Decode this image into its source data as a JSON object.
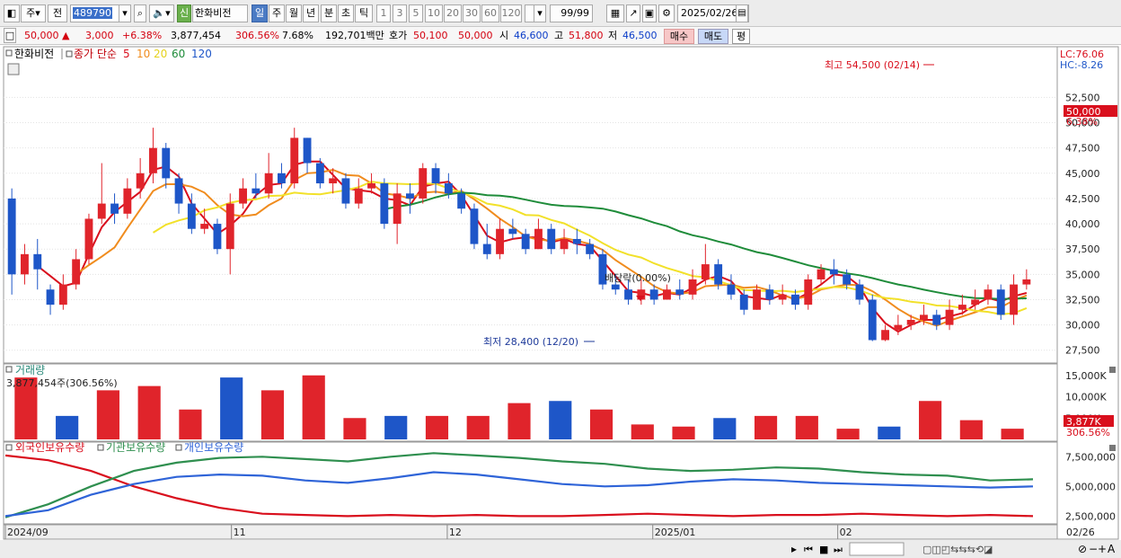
{
  "toolbar": {
    "period_selector": "주",
    "prev_label": "전",
    "stock_code": "489790",
    "market_badge": "신",
    "stock_name": "한화비전",
    "period_tabs": [
      "일",
      "주",
      "월",
      "년",
      "분",
      "초",
      "틱"
    ],
    "active_period": "일",
    "minute_options": [
      "1",
      "3",
      "5",
      "10",
      "20",
      "30",
      "60",
      "120"
    ],
    "count": "99/99",
    "date": "2025/02/26"
  },
  "quote": {
    "price": "50,000",
    "change_arrow": "▲",
    "change": "3,000",
    "change_pct": "+6.38%",
    "volume": "3,877,454",
    "volume_ratio": "306.56%",
    "turnover": "7.68%",
    "amount": "192,701백만",
    "bid_label": "호가",
    "bid": "50,100",
    "ask": "50,000",
    "open_label": "시",
    "open": "46,600",
    "high_label": "고",
    "high": "51,800",
    "low_label": "저",
    "low": "46,500",
    "buy_button": "매수",
    "sell_button": "매도",
    "eval_button": "평"
  },
  "legend": {
    "stock_name": "한화비전",
    "ma_label": "종가 단순",
    "ma_periods": [
      "5",
      "10",
      "20",
      "60",
      "120"
    ],
    "lc_label": "LC:76.06",
    "hc_label": "HC:-8.26"
  },
  "colors": {
    "up": "#e0242b",
    "down": "#1e56c8",
    "ma5": "#d90f1d",
    "ma10": "#f08c1e",
    "ma20": "#f2e12a",
    "ma60": "#1f8c3a",
    "ma120": "#1e56c8",
    "foreign": "#d90f1d",
    "institution": "#2f8f4f",
    "individual": "#2f64d8"
  },
  "annotations": {
    "high_label": "최고 54,500 (02/14)",
    "low_label": "최저 28,400 (12/20)",
    "dividend_label": "배당락(0.00%)",
    "current_price": "50,000",
    "current_pct": "6.38%"
  },
  "volume_panel": {
    "title": "거래량",
    "value_label": "3,877,454주(306.56%)",
    "axis_labels": [
      "15,000K",
      "10,000K",
      "5,000K"
    ],
    "current_label": "3,877K",
    "current_pct": "306.56%"
  },
  "holdings_panel": {
    "legend": [
      "외국인보유수량",
      "기관보유수량",
      "개인보유수량"
    ],
    "axis_labels": [
      "7,500,000",
      "5,000,000",
      "2,500,000"
    ]
  },
  "x_axis": {
    "labels": [
      "2024/09",
      "11",
      "12",
      "2025/01",
      "02",
      "02/26"
    ]
  },
  "chart_data": {
    "type": "candlestick",
    "price_axis": [
      52500,
      50000,
      47500,
      45000,
      42500,
      40000,
      37500,
      35000,
      32500,
      30000,
      27500
    ],
    "ylim": [
      26500,
      56000
    ],
    "candles": [
      [
        42500,
        35000,
        43500,
        33000
      ],
      [
        35000,
        37000,
        38000,
        34000
      ],
      [
        37000,
        35500,
        38500,
        33500
      ],
      [
        33500,
        32000,
        34000,
        31000
      ],
      [
        32000,
        34000,
        35000,
        31500
      ],
      [
        34000,
        36500,
        37500,
        33500
      ],
      [
        36500,
        40500,
        41000,
        36000
      ],
      [
        40500,
        42000,
        46000,
        40000
      ],
      [
        42000,
        41000,
        43000,
        40000
      ],
      [
        41000,
        43500,
        44500,
        40500
      ],
      [
        43500,
        45000,
        46500,
        42500
      ],
      [
        45000,
        47500,
        49500,
        44000
      ],
      [
        47500,
        44500,
        48000,
        43500
      ],
      [
        44500,
        42000,
        45000,
        41000
      ],
      [
        42000,
        39500,
        43000,
        39000
      ],
      [
        39500,
        40000,
        41500,
        39000
      ],
      [
        40000,
        37500,
        40500,
        37000
      ],
      [
        37500,
        42000,
        43000,
        35000
      ],
      [
        42000,
        43500,
        44500,
        41500
      ],
      [
        43500,
        43000,
        45000,
        42500
      ],
      [
        43000,
        45000,
        47000,
        42500
      ],
      [
        45000,
        44000,
        46000,
        43500
      ],
      [
        44000,
        48500,
        49500,
        43500
      ],
      [
        48500,
        46000,
        48500,
        45000
      ],
      [
        46000,
        44000,
        46500,
        43500
      ],
      [
        44000,
        44500,
        45500,
        43000
      ],
      [
        44500,
        42000,
        45000,
        41500
      ],
      [
        42000,
        43500,
        44500,
        41500
      ],
      [
        43500,
        44000,
        45000,
        43000
      ],
      [
        44000,
        40000,
        44500,
        39500
      ],
      [
        40000,
        43000,
        44000,
        38000
      ],
      [
        43000,
        42500,
        44000,
        41000
      ],
      [
        42500,
        45500,
        46000,
        42000
      ],
      [
        45500,
        44000,
        46000,
        43000
      ],
      [
        44000,
        43000,
        45000,
        42500
      ],
      [
        43000,
        41500,
        43500,
        41000
      ],
      [
        41500,
        38000,
        42000,
        37500
      ],
      [
        38000,
        37000,
        40000,
        36500
      ],
      [
        37000,
        39500,
        40500,
        36500
      ],
      [
        39500,
        39000,
        40500,
        38500
      ],
      [
        39000,
        37500,
        39500,
        37000
      ],
      [
        37500,
        39500,
        40500,
        37500
      ],
      [
        39500,
        37500,
        40000,
        37000
      ],
      [
        37500,
        38500,
        39500,
        37000
      ],
      [
        38500,
        38000,
        39500,
        37000
      ],
      [
        38000,
        37000,
        38500,
        36500
      ],
      [
        37000,
        34000,
        37500,
        33500
      ],
      [
        34000,
        33500,
        35000,
        33000
      ],
      [
        33500,
        32500,
        34500,
        32000
      ],
      [
        32500,
        33500,
        34500,
        32000
      ],
      [
        33500,
        32500,
        34000,
        32000
      ],
      [
        32500,
        33500,
        34000,
        32500
      ],
      [
        33500,
        33000,
        34500,
        32500
      ],
      [
        33000,
        34500,
        35500,
        32500
      ],
      [
        34500,
        36000,
        38000,
        34000
      ],
      [
        36000,
        34000,
        36500,
        33500
      ],
      [
        34000,
        33000,
        35000,
        32500
      ],
      [
        33000,
        31500,
        33500,
        31000
      ],
      [
        31500,
        33500,
        34000,
        31500
      ],
      [
        33500,
        32500,
        34000,
        32000
      ],
      [
        32500,
        33000,
        34000,
        32000
      ],
      [
        33000,
        32000,
        33500,
        31500
      ],
      [
        32000,
        34500,
        35000,
        31500
      ],
      [
        34500,
        35500,
        36000,
        34000
      ],
      [
        35500,
        35000,
        36500,
        34000
      ],
      [
        35000,
        34000,
        35500,
        33500
      ],
      [
        34000,
        32500,
        34500,
        32000
      ],
      [
        32500,
        28500,
        33000,
        28400
      ],
      [
        28500,
        29500,
        30000,
        28400
      ],
      [
        29500,
        30000,
        31000,
        29000
      ],
      [
        30000,
        30500,
        31000,
        29500
      ],
      [
        30500,
        31000,
        32000,
        30000
      ],
      [
        31000,
        30000,
        31500,
        29500
      ],
      [
        30000,
        31500,
        32500,
        29500
      ],
      [
        31500,
        32000,
        33000,
        31000
      ],
      [
        32000,
        32500,
        33500,
        31500
      ],
      [
        32500,
        33500,
        34000,
        32000
      ],
      [
        33500,
        31000,
        34000,
        30500
      ],
      [
        31000,
        34000,
        35000,
        30000
      ],
      [
        34000,
        34500,
        35500,
        33500
      ]
    ],
    "volume_k": [
      14500,
      5500,
      11500,
      12500,
      7000,
      14500,
      11500,
      15000,
      5000,
      5500,
      5500,
      5500,
      8500,
      9000,
      7000,
      3500,
      3000,
      5000,
      5500,
      5500,
      2500,
      3000,
      9000,
      4500,
      2500
    ],
    "foreign_m": [
      7.6,
      7.2,
      6.3,
      5.0,
      4.0,
      3.2,
      2.7,
      2.6,
      2.5,
      2.6,
      2.5,
      2.6,
      2.5,
      2.5,
      2.6,
      2.7,
      2.6,
      2.5,
      2.6,
      2.6,
      2.7,
      2.6,
      2.5,
      2.6,
      2.5
    ],
    "institution_m": [
      2.4,
      3.5,
      5.0,
      6.3,
      7.0,
      7.4,
      7.5,
      7.3,
      7.1,
      7.5,
      7.8,
      7.6,
      7.4,
      7.1,
      6.9,
      6.5,
      6.3,
      6.4,
      6.6,
      6.5,
      6.2,
      6.0,
      5.9,
      5.5,
      5.6
    ],
    "individual_m": [
      2.5,
      3.0,
      4.3,
      5.2,
      5.8,
      6.0,
      5.9,
      5.5,
      5.3,
      5.7,
      6.2,
      6.0,
      5.6,
      5.2,
      5.0,
      5.1,
      5.4,
      5.6,
      5.5,
      5.3,
      5.2,
      5.1,
      5.0,
      4.9,
      5.0
    ]
  }
}
